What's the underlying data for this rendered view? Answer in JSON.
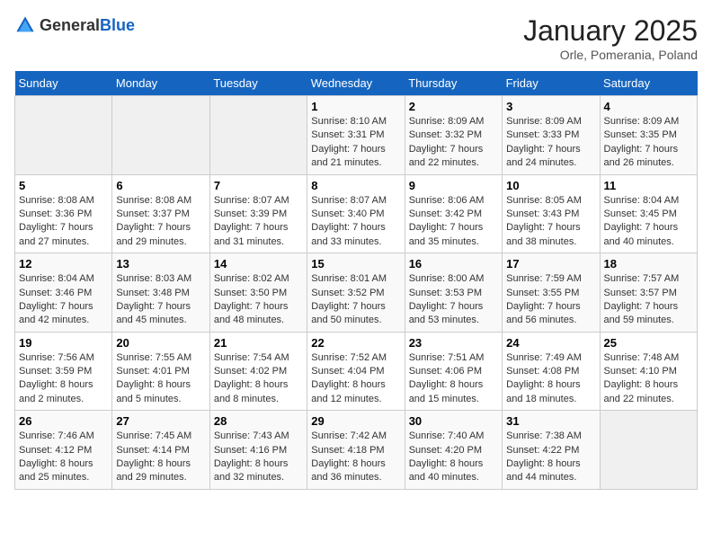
{
  "header": {
    "logo": {
      "text_general": "General",
      "text_blue": "Blue"
    },
    "title": "January 2025",
    "subtitle": "Orle, Pomerania, Poland"
  },
  "days_of_week": [
    "Sunday",
    "Monday",
    "Tuesday",
    "Wednesday",
    "Thursday",
    "Friday",
    "Saturday"
  ],
  "weeks": [
    [
      {
        "day": "",
        "content": ""
      },
      {
        "day": "",
        "content": ""
      },
      {
        "day": "",
        "content": ""
      },
      {
        "day": "1",
        "content": "Sunrise: 8:10 AM\nSunset: 3:31 PM\nDaylight: 7 hours and 21 minutes."
      },
      {
        "day": "2",
        "content": "Sunrise: 8:09 AM\nSunset: 3:32 PM\nDaylight: 7 hours and 22 minutes."
      },
      {
        "day": "3",
        "content": "Sunrise: 8:09 AM\nSunset: 3:33 PM\nDaylight: 7 hours and 24 minutes."
      },
      {
        "day": "4",
        "content": "Sunrise: 8:09 AM\nSunset: 3:35 PM\nDaylight: 7 hours and 26 minutes."
      }
    ],
    [
      {
        "day": "5",
        "content": "Sunrise: 8:08 AM\nSunset: 3:36 PM\nDaylight: 7 hours and 27 minutes."
      },
      {
        "day": "6",
        "content": "Sunrise: 8:08 AM\nSunset: 3:37 PM\nDaylight: 7 hours and 29 minutes."
      },
      {
        "day": "7",
        "content": "Sunrise: 8:07 AM\nSunset: 3:39 PM\nDaylight: 7 hours and 31 minutes."
      },
      {
        "day": "8",
        "content": "Sunrise: 8:07 AM\nSunset: 3:40 PM\nDaylight: 7 hours and 33 minutes."
      },
      {
        "day": "9",
        "content": "Sunrise: 8:06 AM\nSunset: 3:42 PM\nDaylight: 7 hours and 35 minutes."
      },
      {
        "day": "10",
        "content": "Sunrise: 8:05 AM\nSunset: 3:43 PM\nDaylight: 7 hours and 38 minutes."
      },
      {
        "day": "11",
        "content": "Sunrise: 8:04 AM\nSunset: 3:45 PM\nDaylight: 7 hours and 40 minutes."
      }
    ],
    [
      {
        "day": "12",
        "content": "Sunrise: 8:04 AM\nSunset: 3:46 PM\nDaylight: 7 hours and 42 minutes."
      },
      {
        "day": "13",
        "content": "Sunrise: 8:03 AM\nSunset: 3:48 PM\nDaylight: 7 hours and 45 minutes."
      },
      {
        "day": "14",
        "content": "Sunrise: 8:02 AM\nSunset: 3:50 PM\nDaylight: 7 hours and 48 minutes."
      },
      {
        "day": "15",
        "content": "Sunrise: 8:01 AM\nSunset: 3:52 PM\nDaylight: 7 hours and 50 minutes."
      },
      {
        "day": "16",
        "content": "Sunrise: 8:00 AM\nSunset: 3:53 PM\nDaylight: 7 hours and 53 minutes."
      },
      {
        "day": "17",
        "content": "Sunrise: 7:59 AM\nSunset: 3:55 PM\nDaylight: 7 hours and 56 minutes."
      },
      {
        "day": "18",
        "content": "Sunrise: 7:57 AM\nSunset: 3:57 PM\nDaylight: 7 hours and 59 minutes."
      }
    ],
    [
      {
        "day": "19",
        "content": "Sunrise: 7:56 AM\nSunset: 3:59 PM\nDaylight: 8 hours and 2 minutes."
      },
      {
        "day": "20",
        "content": "Sunrise: 7:55 AM\nSunset: 4:01 PM\nDaylight: 8 hours and 5 minutes."
      },
      {
        "day": "21",
        "content": "Sunrise: 7:54 AM\nSunset: 4:02 PM\nDaylight: 8 hours and 8 minutes."
      },
      {
        "day": "22",
        "content": "Sunrise: 7:52 AM\nSunset: 4:04 PM\nDaylight: 8 hours and 12 minutes."
      },
      {
        "day": "23",
        "content": "Sunrise: 7:51 AM\nSunset: 4:06 PM\nDaylight: 8 hours and 15 minutes."
      },
      {
        "day": "24",
        "content": "Sunrise: 7:49 AM\nSunset: 4:08 PM\nDaylight: 8 hours and 18 minutes."
      },
      {
        "day": "25",
        "content": "Sunrise: 7:48 AM\nSunset: 4:10 PM\nDaylight: 8 hours and 22 minutes."
      }
    ],
    [
      {
        "day": "26",
        "content": "Sunrise: 7:46 AM\nSunset: 4:12 PM\nDaylight: 8 hours and 25 minutes."
      },
      {
        "day": "27",
        "content": "Sunrise: 7:45 AM\nSunset: 4:14 PM\nDaylight: 8 hours and 29 minutes."
      },
      {
        "day": "28",
        "content": "Sunrise: 7:43 AM\nSunset: 4:16 PM\nDaylight: 8 hours and 32 minutes."
      },
      {
        "day": "29",
        "content": "Sunrise: 7:42 AM\nSunset: 4:18 PM\nDaylight: 8 hours and 36 minutes."
      },
      {
        "day": "30",
        "content": "Sunrise: 7:40 AM\nSunset: 4:20 PM\nDaylight: 8 hours and 40 minutes."
      },
      {
        "day": "31",
        "content": "Sunrise: 7:38 AM\nSunset: 4:22 PM\nDaylight: 8 hours and 44 minutes."
      },
      {
        "day": "",
        "content": ""
      }
    ]
  ]
}
